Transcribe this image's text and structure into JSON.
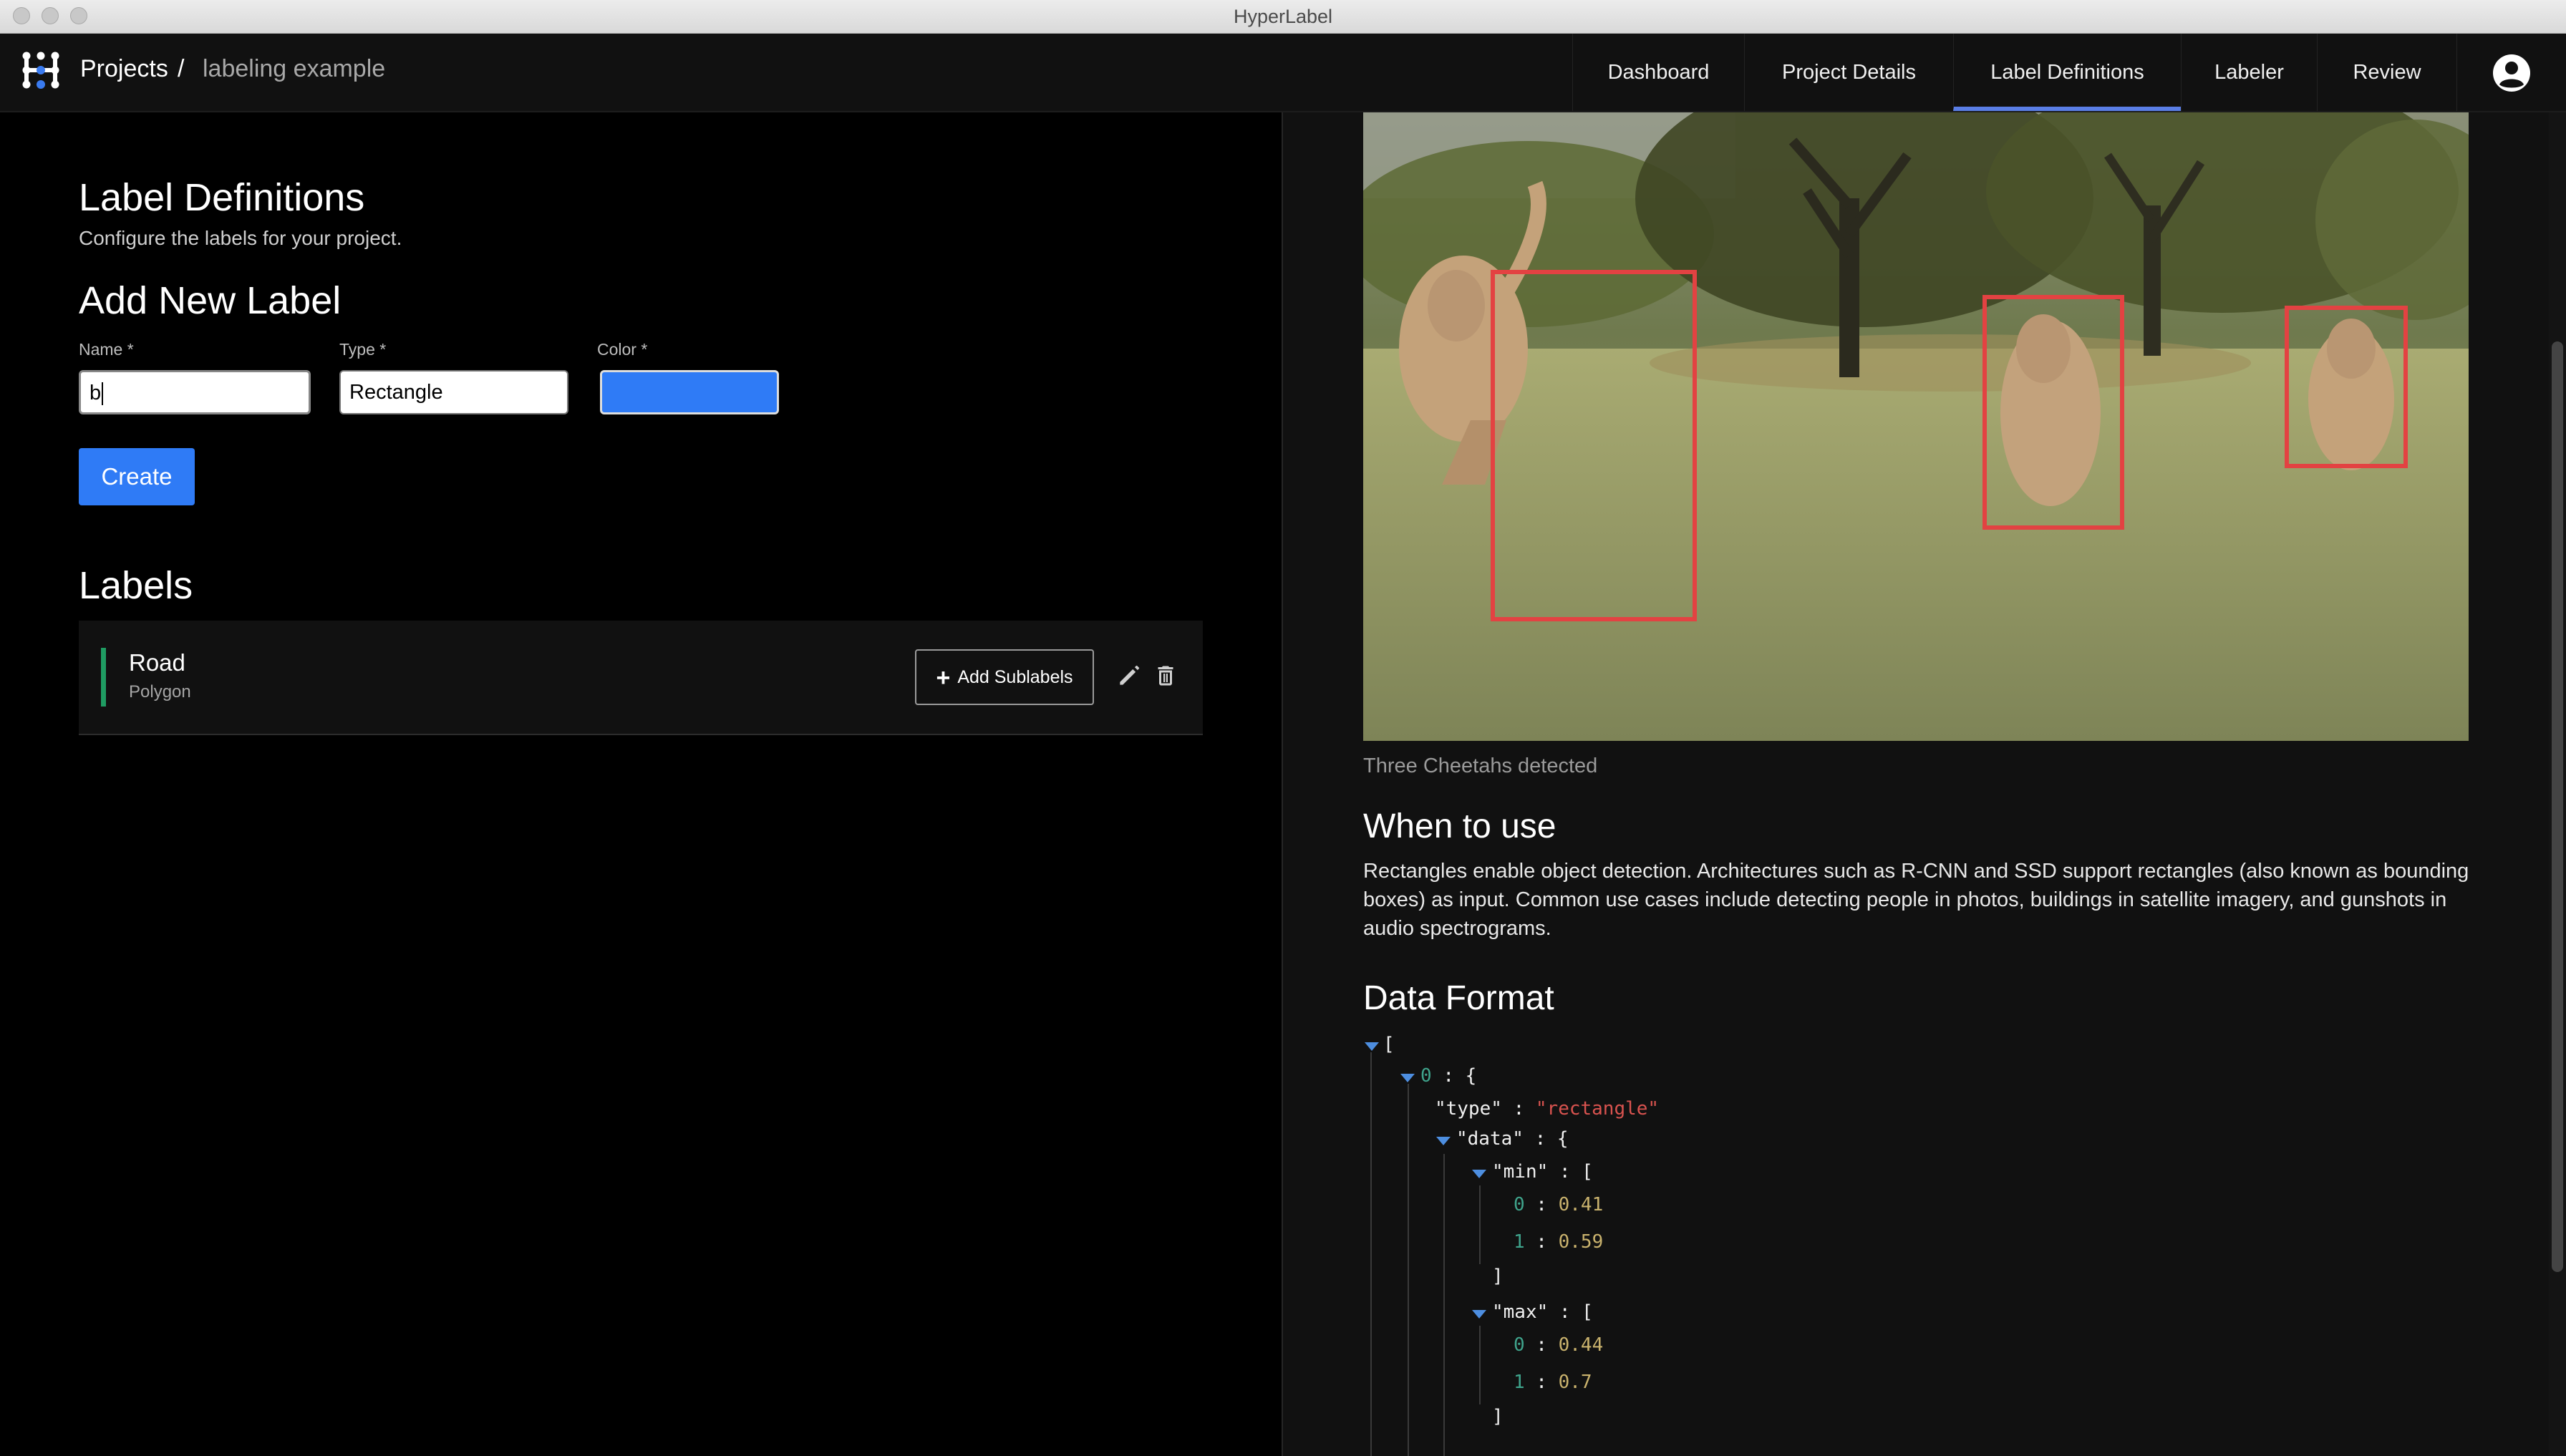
{
  "window": {
    "title": "HyperLabel"
  },
  "header": {
    "breadcrumb": {
      "root": "Projects",
      "separator": "/",
      "current": "labeling example"
    },
    "tabs": [
      {
        "label": "Dashboard",
        "active": false
      },
      {
        "label": "Project Details",
        "active": false
      },
      {
        "label": "Label Definitions",
        "active": true
      },
      {
        "label": "Labeler",
        "active": false
      },
      {
        "label": "Review",
        "active": false
      }
    ],
    "user_icon": "account-circle-icon",
    "accent_color": "#5a7ee6"
  },
  "left": {
    "title": "Label Definitions",
    "subtitle": "Configure the labels for your project.",
    "add_title": "Add New Label",
    "form": {
      "name_label": "Name *",
      "name_value": "b",
      "type_label": "Type *",
      "type_value": "Rectangle",
      "color_label": "Color *",
      "color_value": "#2f7bf6",
      "create_label": "Create"
    },
    "labels_title": "Labels",
    "labels": [
      {
        "name": "Road",
        "type": "Polygon",
        "color": "#1f9c62",
        "add_sublabels": "Add Sublabels"
      }
    ]
  },
  "right": {
    "image_caption": "Three Cheetahs detected",
    "when_title": "When to use",
    "when_text": "Rectangles enable object detection. Architectures such as R-CNN and SSD support rectangles (also known as bounding boxes) as input. Common use cases include detecting people in photos, buildings in satellite imagery, and gunshots in audio spectrograms.",
    "data_format_title": "Data Format",
    "json_tree": {
      "open_bracket": "[",
      "item_index": "0",
      "item_open": ": {",
      "type_key": "\"type\"",
      "type_value": "\"rectangle\"",
      "data_key": "\"data\"",
      "data_open": ": {",
      "min_key": "\"min\"",
      "min_values": [
        "0.41",
        "0.59"
      ],
      "max_key": "\"max\"",
      "max_values": [
        "0.44",
        "0.7"
      ],
      "close_bracket": "]"
    }
  }
}
